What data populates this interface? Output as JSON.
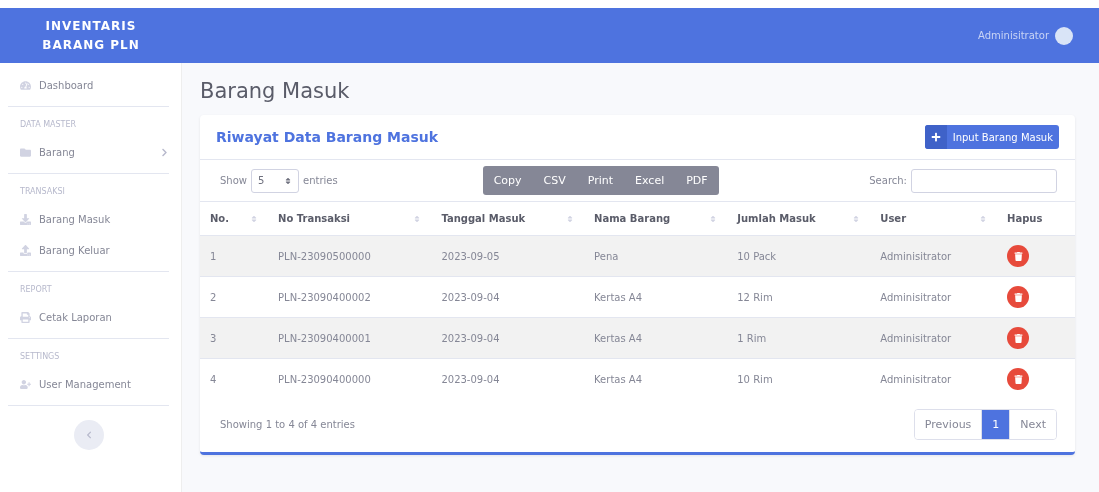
{
  "brand": {
    "lines": [
      "INVENTARIS",
      "BARANG PLN"
    ]
  },
  "topbar": {
    "user": "Adminisitrator"
  },
  "sidebar": {
    "sections": [
      {
        "items": [
          {
            "label": "Dashboard",
            "has_submenu": false
          }
        ]
      },
      {
        "heading": "DATA MASTER",
        "items": [
          {
            "label": "Barang",
            "has_submenu": true
          }
        ]
      },
      {
        "heading": "TRANSAKSI",
        "items": [
          {
            "label": "Barang Masuk",
            "has_submenu": false
          },
          {
            "label": "Barang Keluar",
            "has_submenu": false
          }
        ]
      },
      {
        "heading": "REPORT",
        "items": [
          {
            "label": "Cetak Laporan",
            "has_submenu": false
          }
        ]
      },
      {
        "heading": "SETTINGS",
        "items": [
          {
            "label": "User Management",
            "has_submenu": false
          }
        ]
      }
    ]
  },
  "page_title": "Barang Masuk",
  "card": {
    "title": "Riwayat Data Barang Masuk",
    "add_button": "Input Barang Masuk",
    "length": {
      "before": "Show",
      "value": "5",
      "after": "entries"
    },
    "export_buttons": [
      "Copy",
      "CSV",
      "Print",
      "Excel",
      "PDF"
    ],
    "search": {
      "label": "Search:"
    },
    "columns": [
      {
        "label": "No.",
        "sortable": true
      },
      {
        "label": "No Transaksi",
        "sortable": true
      },
      {
        "label": "Tanggal Masuk",
        "sortable": true
      },
      {
        "label": "Nama Barang",
        "sortable": true
      },
      {
        "label": "Jumlah Masuk",
        "sortable": true
      },
      {
        "label": "User",
        "sortable": true
      },
      {
        "label": "Hapus",
        "sortable": false
      }
    ],
    "rows": [
      {
        "cells": [
          "1",
          "PLN-23090500000",
          "2023-09-05",
          "Pena",
          "10 Pack",
          "Adminisitrator"
        ]
      },
      {
        "cells": [
          "2",
          "PLN-23090400002",
          "2023-09-04",
          "Kertas A4",
          "12 Rim",
          "Adminisitrator"
        ]
      },
      {
        "cells": [
          "3",
          "PLN-23090400001",
          "2023-09-04",
          "Kertas A4",
          "1 Rim",
          "Adminisitrator"
        ]
      },
      {
        "cells": [
          "4",
          "PLN-23090400000",
          "2023-09-04",
          "Kertas A4",
          "10 Rim",
          "Adminisitrator"
        ]
      }
    ],
    "info": "Showing 1 to 4 of 4 entries",
    "pagination": [
      {
        "label": "Previous",
        "selected": false
      },
      {
        "label": "1",
        "selected": true
      },
      {
        "label": "Next",
        "selected": false
      }
    ]
  }
}
